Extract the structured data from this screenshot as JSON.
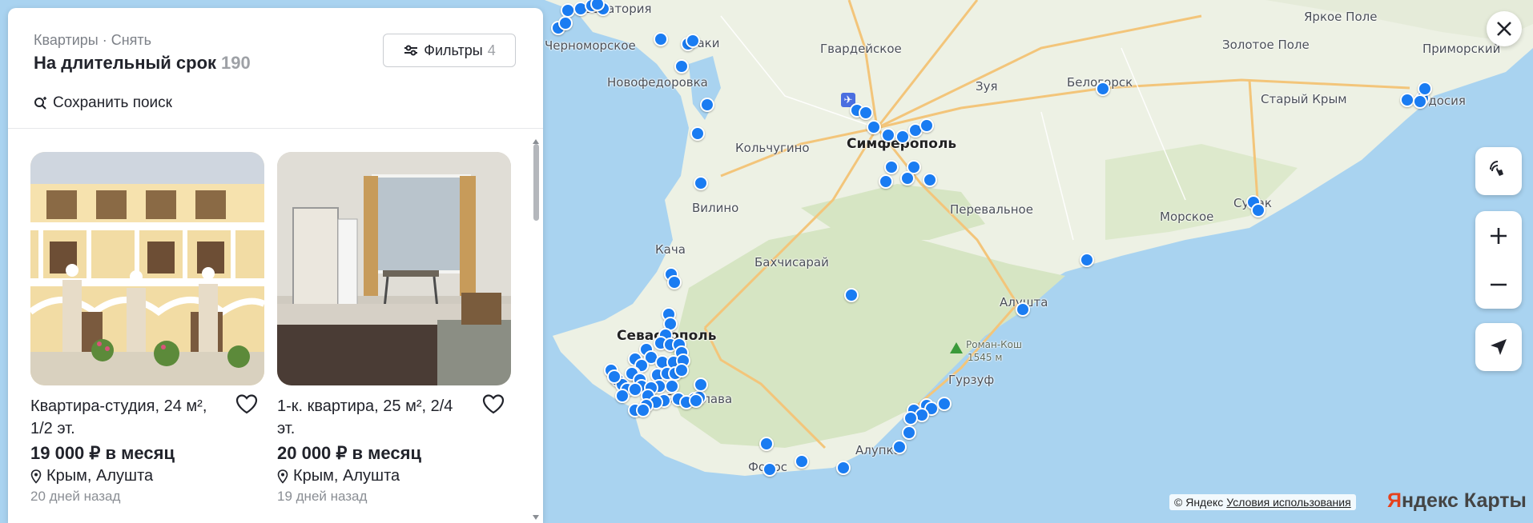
{
  "panel": {
    "breadcrumb": "Квартиры · Снять",
    "title": "На длительный срок",
    "count": "190",
    "filters_label": "Фильтры",
    "filters_count": "4",
    "save_search": "Сохранить поиск"
  },
  "listings": [
    {
      "name": "Квартира-студия, 24 м², 1/2 эт.",
      "price": "19 000 ₽ в месяц",
      "location": "Крым, Алушта",
      "date": "20 дней назад"
    },
    {
      "name": "1-к. квартира, 25 м², 2/4 эт.",
      "price": "20 000 ₽ в месяц",
      "location": "Крым, Алушта",
      "date": "19 дней назад"
    }
  ],
  "map": {
    "cities": [
      {
        "name": "Гвардейское"
      },
      {
        "name": "Яркое Поле"
      },
      {
        "name": "Золотое Поле"
      },
      {
        "name": "Приморский"
      },
      {
        "name": "Новофедоровка"
      },
      {
        "name": "Зуя"
      },
      {
        "name": "Белогорск"
      },
      {
        "name": "Старый Крым"
      },
      {
        "name": "Феодосия"
      },
      {
        "name": "Кольчугино"
      },
      {
        "name": "Симферополь"
      },
      {
        "name": "Вилино"
      },
      {
        "name": "Перевальное"
      },
      {
        "name": "Морское"
      },
      {
        "name": "Судак"
      },
      {
        "name": "Кача"
      },
      {
        "name": "Бахчисарай"
      },
      {
        "name": "Алушта"
      },
      {
        "name": "Севастополь"
      },
      {
        "name": "Роман-Кош"
      },
      {
        "name": "1545 м"
      },
      {
        "name": "Гурзуф"
      },
      {
        "name": "Балаклава"
      },
      {
        "name": "Алупка"
      },
      {
        "name": "Форос"
      },
      {
        "name": "Евпатория"
      },
      {
        "name": "Саки"
      },
      {
        "name": "Черноморское"
      }
    ],
    "copyright": "© Яндекс",
    "terms": "Условия использования",
    "logo_prefix": "Я",
    "logo_rest": "ндекс Карты"
  },
  "controls": {
    "close_icon": "close-icon",
    "gesture_icon": "hand-gesture-icon",
    "zoom_in_icon": "plus-icon",
    "zoom_out_icon": "minus-icon",
    "locate_icon": "geolocation-arrow-icon"
  },
  "colors": {
    "marker": "#1a7cf2",
    "sea": "#a9d3f0",
    "land": "#e9efe1"
  }
}
